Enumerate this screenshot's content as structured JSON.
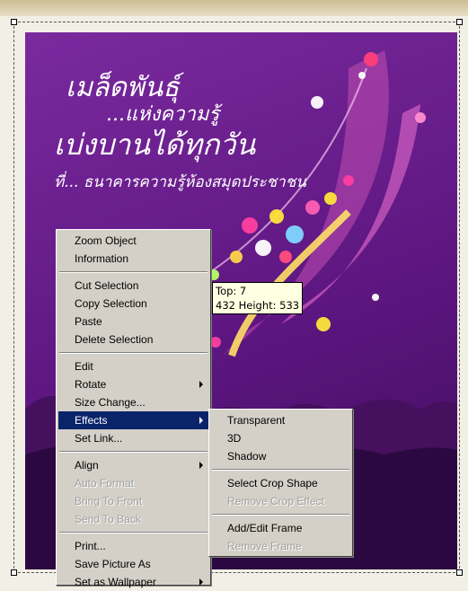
{
  "poster": {
    "line1": "เมล็ดพันธุ์",
    "line2": "...แห่งความรู้",
    "line3": "เบ่งบานได้ทุกวัน",
    "line4": "ที่... ธนาคารความรู้ห้องสมุดประชาชน"
  },
  "tooltip": {
    "line1": "Top: 7",
    "line2": "432 Height: 533"
  },
  "context_menu": {
    "zoom_object": "Zoom Object",
    "information": "Information",
    "cut_selection": "Cut Selection",
    "copy_selection": "Copy Selection",
    "paste": "Paste",
    "delete_selection": "Delete Selection",
    "edit": "Edit",
    "rotate": "Rotate",
    "size_change": "Size Change...",
    "effects": "Effects",
    "set_link": "Set Link...",
    "align": "Align",
    "auto_format": "Auto Format",
    "bring_to_front": "Bring To Front",
    "send_to_back": "Send To Back",
    "print": "Print...",
    "save_picture_as": "Save Picture As",
    "set_as_wallpaper": "Set as Wallpaper"
  },
  "effects_submenu": {
    "transparent": "Transparent",
    "three_d": "3D",
    "shadow": "Shadow",
    "select_crop_shape": "Select Crop Shape",
    "remove_crop_effect": "Remove Crop Effect",
    "add_edit_frame": "Add/Edit Frame",
    "remove_frame": "Remove Frame"
  },
  "colors": {
    "menu_background": "#d4d0c8",
    "menu_highlight": "#0a246a",
    "tooltip_background": "#ffffe1",
    "poster_purple": "#5d1680"
  }
}
